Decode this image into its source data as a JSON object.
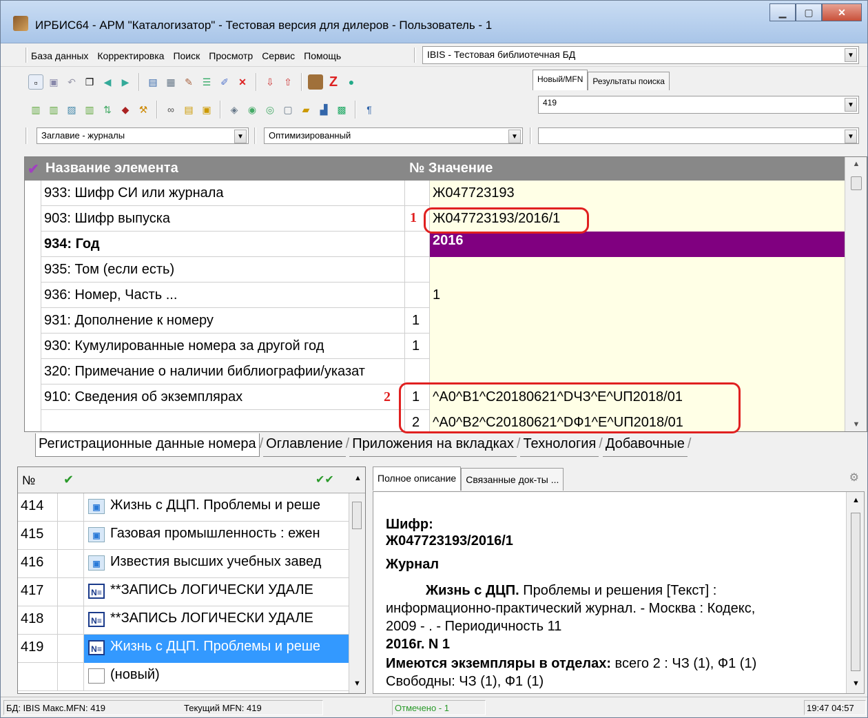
{
  "window": {
    "title": "ИРБИС64 - АРМ \"Каталогизатор\" - Тестовая версия для дилеров - Пользователь - 1"
  },
  "menu": [
    "База данных",
    "Корректировка",
    "Поиск",
    "Просмотр",
    "Сервис",
    "Помощь"
  ],
  "database_select": "IBIS - Тестовая библиотечная БД",
  "search_tabs": [
    "Новый/MFN",
    "Результаты поиска"
  ],
  "mfn_value": "419",
  "worksheet_select": "Заглавие - журналы",
  "mode_select": "Оптимизированный",
  "grid": {
    "headers": {
      "name": "Название элемента",
      "num": "№",
      "value": "Значение"
    },
    "rows": [
      {
        "name": "933: Шифр СИ или журнала",
        "num": "",
        "value": "Ж047723193"
      },
      {
        "name": "903: Шифр выпуска",
        "num": "",
        "value": "Ж047723193/2016/1"
      },
      {
        "name": "934: Год",
        "num": "",
        "value": "2016"
      },
      {
        "name": "935: Том (если есть)",
        "num": "",
        "value": ""
      },
      {
        "name": "936: Номер, Часть ...",
        "num": "",
        "value": "1"
      },
      {
        "name": "931: Дополнение к номеру",
        "num": "1",
        "value": ""
      },
      {
        "name": "930: Кумулированные номера за другой год",
        "num": "1",
        "value": ""
      },
      {
        "name": "320: Примечание о наличии библиографии/указат",
        "num": "",
        "value": ""
      },
      {
        "name": "910: Сведения об экземплярах",
        "num": "1",
        "value": "^A0^B1^C20180621^DЧЗ^E^UП2018/01"
      },
      {
        "name": "",
        "num": "2",
        "value": "^A0^B2^C20180621^DФ1^E^UП2018/01"
      }
    ],
    "markers": [
      "1",
      "2"
    ]
  },
  "bottom_tabs": [
    "Регистрационные данные номера",
    "Оглавление",
    "Приложения на вкладках",
    "Технология",
    "Добавочные"
  ],
  "list": {
    "header_num": "№",
    "rows": [
      {
        "num": "414",
        "title": "Жизнь с ДЦП. Проблемы и реше",
        "icon": "record-icon"
      },
      {
        "num": "415",
        "title": "Газовая промышленность : ежен",
        "icon": "record-icon"
      },
      {
        "num": "416",
        "title": "Известия высших учебных завед",
        "icon": "record-icon"
      },
      {
        "num": "417",
        "title": "**ЗАПИСЬ ЛОГИЧЕСКИ УДАЛЕ",
        "icon": "deleted-record-icon"
      },
      {
        "num": "418",
        "title": "**ЗАПИСЬ ЛОГИЧЕСКИ УДАЛЕ",
        "icon": "deleted-record-icon"
      },
      {
        "num": "419",
        "title": "Жизнь с ДЦП. Проблемы и реше",
        "icon": "deleted-record-icon"
      },
      {
        "num": "",
        "title": "(новый)",
        "icon": "new-record-icon"
      }
    ]
  },
  "description": {
    "tabs": [
      "Полное описание",
      "Связанные док-ты ..."
    ],
    "shifr_label": "Шифр:",
    "shifr_value": "Ж047723193/2016/1",
    "type": "Журнал",
    "title_bold": "Жизнь с ДЦП.",
    "title_rest": " Проблемы и решения [Текст] :",
    "line2": "информационно-практический журнал. - Москва : Кодекс,",
    "line3": "2009 - . - Периодичность 11",
    "issue": "2016г. N 1",
    "copies_label": "Имеются экземпляры в отделах:",
    "copies_value": " всего 2 : ЧЗ (1), Ф1 (1)",
    "free": "Свободны: ЧЗ (1), Ф1 (1)"
  },
  "status": {
    "db": "БД: IBIS Макс.MFN: 419",
    "current": "Текущий MFN: 419",
    "marked": "Отмечено - 1",
    "time": "19:47 04:57"
  },
  "colors": {
    "selected_value": "#800080",
    "value_bg": "#ffffe6",
    "highlight": "#e02020",
    "list_selection": "#3399ff"
  }
}
